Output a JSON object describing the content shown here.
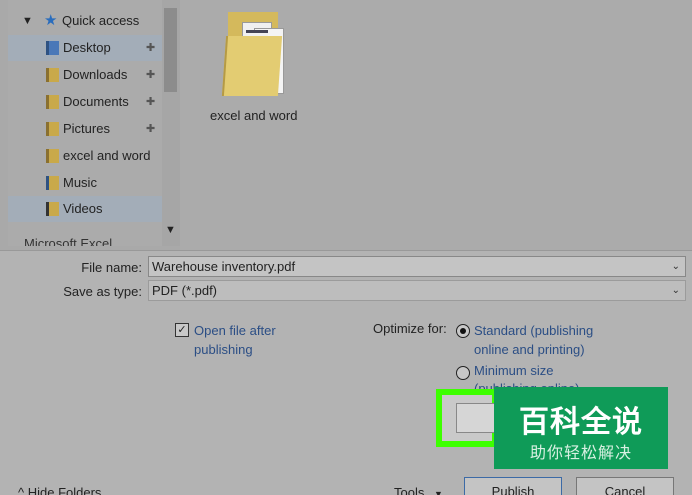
{
  "nav": {
    "quick_access": "Quick access",
    "items": [
      {
        "label": "Desktop",
        "icon": "desktop-folder-icon",
        "pinned": true
      },
      {
        "label": "Downloads",
        "icon": "downloads-folder-icon",
        "pinned": true
      },
      {
        "label": "Documents",
        "icon": "documents-folder-icon",
        "pinned": true
      },
      {
        "label": "Pictures",
        "icon": "pictures-folder-icon",
        "pinned": true
      },
      {
        "label": "excel and word",
        "icon": "folder-icon",
        "pinned": false
      },
      {
        "label": "Music",
        "icon": "music-folder-icon",
        "pinned": false
      },
      {
        "label": "Videos",
        "icon": "videos-folder-icon",
        "pinned": false
      }
    ],
    "partial_item": "Microsoft Excel"
  },
  "content": {
    "folders": [
      {
        "name": "excel and word"
      }
    ]
  },
  "form": {
    "file_name_label": "File name:",
    "file_name_value": "Warehouse inventory.pdf",
    "save_type_label": "Save as type:",
    "save_type_value": "PDF (*.pdf)",
    "open_after_label": "Open file after publishing",
    "open_after_checked": true,
    "optimize_label": "Optimize for:",
    "standard_label": "Standard (publishing online and printing)",
    "minimum_label": "Minimum size",
    "minimum_sub": "(publishing online)"
  },
  "footer": {
    "hide_folders": "Hide Folders",
    "tools": "Tools",
    "publish": "Publish",
    "cancel": "Cancel"
  },
  "watermark": {
    "title": "百科全说",
    "subtitle": "助你轻松解决"
  },
  "colors": {
    "highlight": "#3dff00",
    "watermark_bg": "#0f9b58",
    "link_blue": "#2b4e85"
  }
}
